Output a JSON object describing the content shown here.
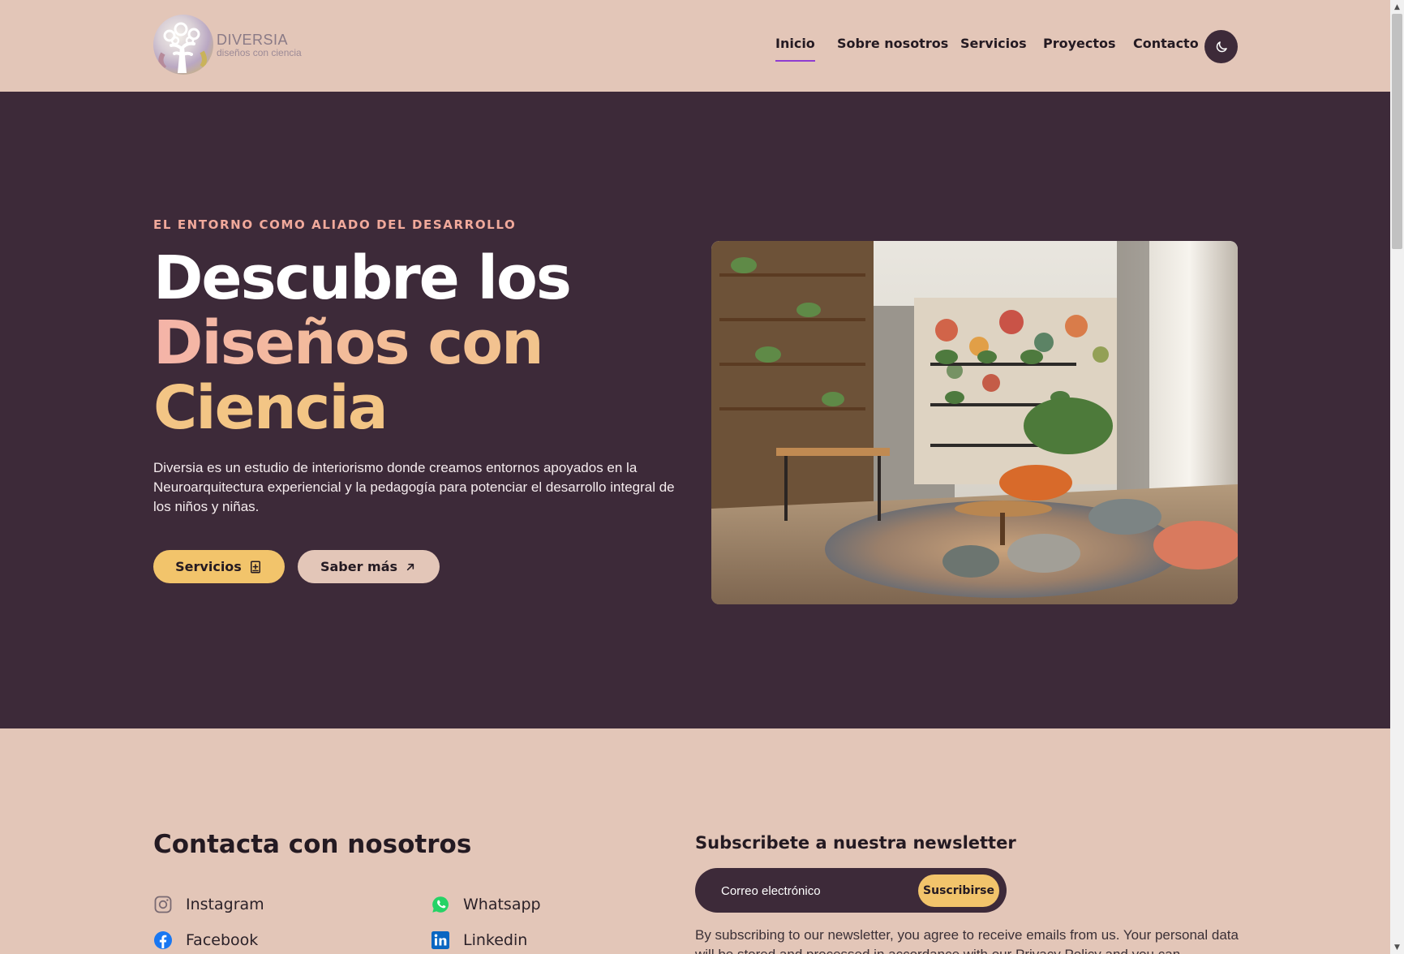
{
  "brand": {
    "name": "DIVERSIA",
    "tagline": "diseños con ciencia"
  },
  "nav": {
    "items": [
      {
        "label": "Inicio",
        "active": true
      },
      {
        "label": "Sobre nosotros",
        "active": false
      },
      {
        "label": "Servicios",
        "active": false
      },
      {
        "label": "Proyectos",
        "active": false
      },
      {
        "label": "Contacto",
        "active": false
      }
    ],
    "theme_toggle_icon": "moon-icon"
  },
  "hero": {
    "eyebrow": "EL ENTORNO COMO ALIADO DEL DESARROLLO",
    "title_line1": "Descubre los",
    "title_line2": "Diseños con",
    "title_line3": "Ciencia",
    "description": "Diversia es un estudio de interiorismo donde creamos entornos apoyados en la Neuroarquitectura experiencial y la pedagogía para potenciar el desarrollo integral de los niños y niñas.",
    "primary_button": "Servicios",
    "secondary_button": "Saber más"
  },
  "contact": {
    "title": "Contacta con nosotros",
    "socials": [
      {
        "label": "Instagram",
        "icon": "instagram-icon"
      },
      {
        "label": "Whatsapp",
        "icon": "whatsapp-icon"
      },
      {
        "label": "Facebook",
        "icon": "facebook-icon"
      },
      {
        "label": "Linkedin",
        "icon": "linkedin-icon"
      }
    ]
  },
  "newsletter": {
    "title": "Subscribete a nuestra newsletter",
    "placeholder": "Correo electrónico",
    "button": "Suscribirse",
    "legal": "By subscribing to our newsletter, you agree to receive emails from us. Your personal data will be stored and processed in accordance with our Privacy Policy and you can"
  },
  "colors": {
    "page_bg": "#e3c6b8",
    "hero_bg": "#3d2a39",
    "accent_yellow": "#f2c46b",
    "accent_pink": "#f1a99b",
    "nav_underline": "#8f3dd1"
  }
}
